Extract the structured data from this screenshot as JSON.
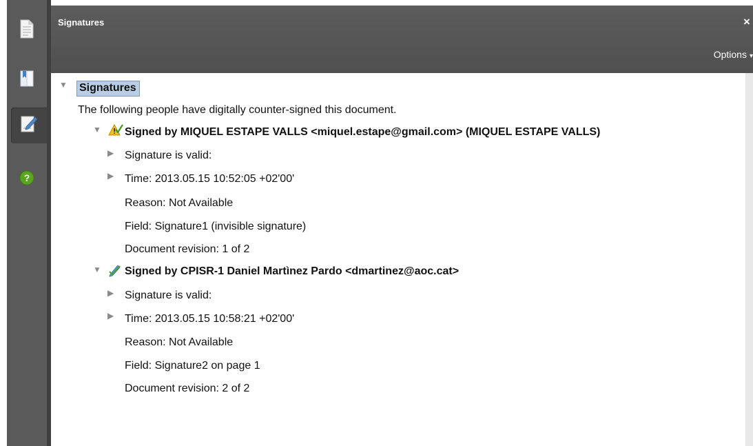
{
  "panel": {
    "title": "Signatures",
    "close_label": "×",
    "options_label": "Options",
    "options_caret": "▾"
  },
  "toolbar": {
    "items": [
      {
        "icon": "page-thumbnails-icon"
      },
      {
        "icon": "bookmarks-icon"
      },
      {
        "icon": "signatures-icon",
        "active": true
      },
      {
        "icon": "help-icon",
        "glyph": "?"
      }
    ]
  },
  "tree": {
    "root_label": "Signatures",
    "description": "The following people have digitally counter-signed this document.",
    "signatures": [
      {
        "title": "Signed by MIQUEL ESTAPE VALLS <miquel.estape@gmail.com> (MIQUEL ESTAPE VALLS)",
        "status_icon": "warning-signature-icon",
        "validity": "Signature is valid:",
        "time": "Time: 2013.05.15 10:52:05 +02'00'",
        "reason": "Reason: Not Available",
        "field": "Field: Signature1 (invisible signature)",
        "revision": "Document revision: 1 of 2"
      },
      {
        "title": "Signed by CPISR-1 Daniel Martìnez Pardo <dmartinez@aoc.cat>",
        "status_icon": "pen-signature-icon",
        "validity": "Signature is valid:",
        "time": "Time: 2013.05.15 10:58:21 +02'00'",
        "reason": "Reason: Not Available",
        "field": "Field: Signature2 on page 1",
        "revision": "Document revision: 2 of 2"
      }
    ]
  },
  "colors": {
    "toolbar_bg": "#5a5a5a",
    "header_bg": "#555555",
    "selection_bg": "#b9cde3",
    "help_green": "#5aa51f"
  }
}
